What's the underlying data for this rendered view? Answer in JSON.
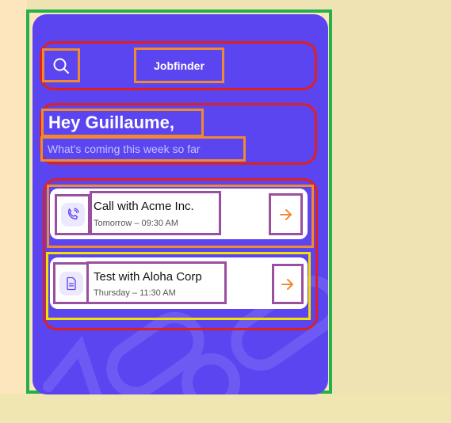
{
  "header": {
    "app_title": "Jobfinder",
    "search_icon": "search-icon"
  },
  "greeting": {
    "title": "Hey Guillaume,",
    "subtitle": "What's coming this week so far"
  },
  "events": [
    {
      "title": "Call with Acme Inc.",
      "time": "Tomorrow – 09:30 AM",
      "icon": "phone-icon"
    },
    {
      "title": "Test with Aloha Corp",
      "time": "Thursday – 11:30 AM",
      "icon": "document-icon"
    }
  ],
  "colors": {
    "card_background": "#5b45f0",
    "accent": "#f08a30",
    "frame_green": "#22b14c",
    "annotation_red": "#e02020",
    "annotation_orange": "#f08a30",
    "annotation_purple": "#9a4fa0",
    "annotation_yellow": "#f2e000"
  }
}
